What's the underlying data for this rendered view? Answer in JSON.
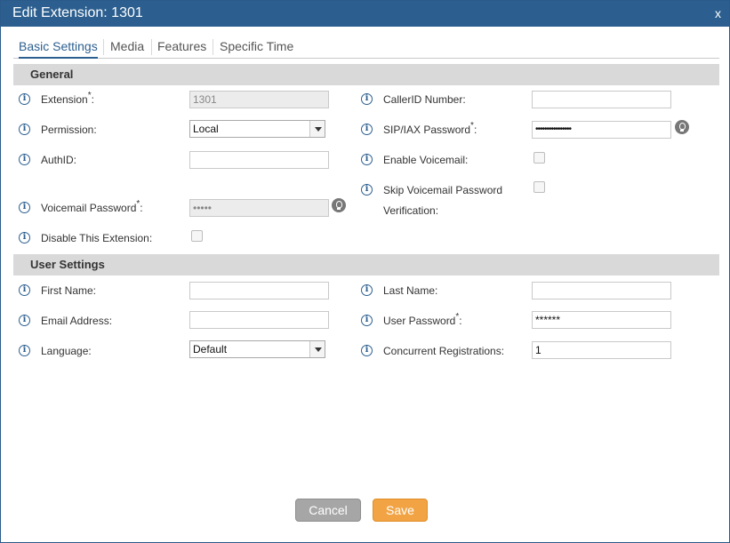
{
  "dialog": {
    "title": "Edit Extension: 1301",
    "close_label": "x"
  },
  "tabs": [
    "Basic Settings",
    "Media",
    "Features",
    "Specific Time"
  ],
  "sections": {
    "general": "General",
    "user_settings": "User Settings"
  },
  "fields": {
    "extension": {
      "label": "Extension",
      "required": "*",
      "colon": ":",
      "value": "1301"
    },
    "permission": {
      "label": "Permission:",
      "value": "Local"
    },
    "authid": {
      "label": "AuthID:",
      "value": ""
    },
    "voicemail_password": {
      "label": "Voicemail Password",
      "required": "*",
      "colon": ":",
      "value": "•••••"
    },
    "disable_extension": {
      "label": "Disable This Extension:"
    },
    "callerid_number": {
      "label": "CallerID Number:",
      "value": ""
    },
    "sip_iax_password": {
      "label": "SIP/IAX Password",
      "required": "*",
      "colon": ":",
      "value": "••••••••••••••••"
    },
    "enable_voicemail": {
      "label": "Enable Voicemail:"
    },
    "skip_voicemail_pw": {
      "label_line1": "Skip Voicemail Password",
      "label_line2": "Verification:"
    },
    "first_name": {
      "label": "First Name:",
      "value": ""
    },
    "email": {
      "label": "Email Address:",
      "value": ""
    },
    "language": {
      "label": "Language:",
      "value": "Default"
    },
    "last_name": {
      "label": "Last Name:",
      "value": ""
    },
    "user_password": {
      "label": "User Password",
      "required": "*",
      "colon": ":",
      "value": "******"
    },
    "concurrent_registrations": {
      "label": "Concurrent Registrations:",
      "value": "1"
    }
  },
  "buttons": {
    "cancel": "Cancel",
    "save": "Save"
  },
  "icons": {
    "info": "info-icon",
    "hint": "lightbulb-icon",
    "dropdown": "chevron-down-icon"
  },
  "colors": {
    "titlebar": "#2c5f8f",
    "save": "#f2a444",
    "cancel": "#a6a6a6"
  }
}
